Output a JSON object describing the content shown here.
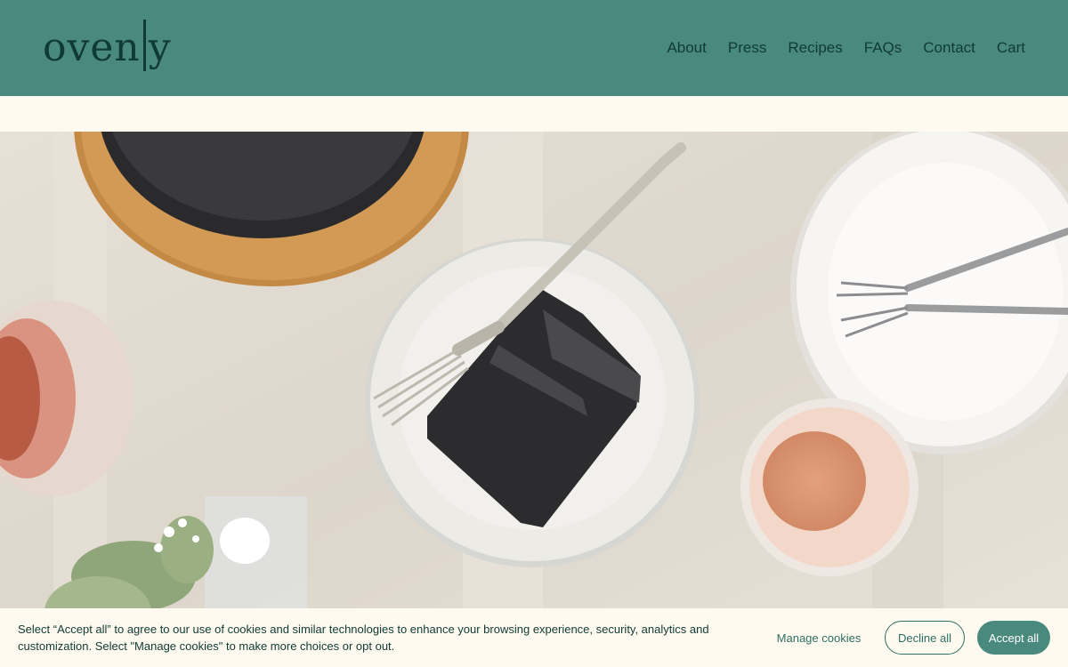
{
  "header": {
    "logo_text_left": "oven",
    "logo_text_right": "y",
    "nav": [
      {
        "label": "About"
      },
      {
        "label": "Press"
      },
      {
        "label": "Recipes"
      },
      {
        "label": "FAQs"
      },
      {
        "label": "Contact"
      },
      {
        "label": "Cart"
      }
    ]
  },
  "hero": {
    "image_name": "black-cake-table-photo"
  },
  "cookie_banner": {
    "text": "Select “Accept all” to agree to our use of cookies and similar technologies to enhance your browsing experience, security, analytics and customization. Select \"Manage cookies\" to make more choices or opt out.",
    "manage_label": "Manage cookies",
    "decline_label": "Decline all",
    "accept_label": "Accept all"
  },
  "colors": {
    "header_bg": "#4a8a7e",
    "text_dark": "#0f3b34",
    "page_bg": "#fefaf0"
  }
}
